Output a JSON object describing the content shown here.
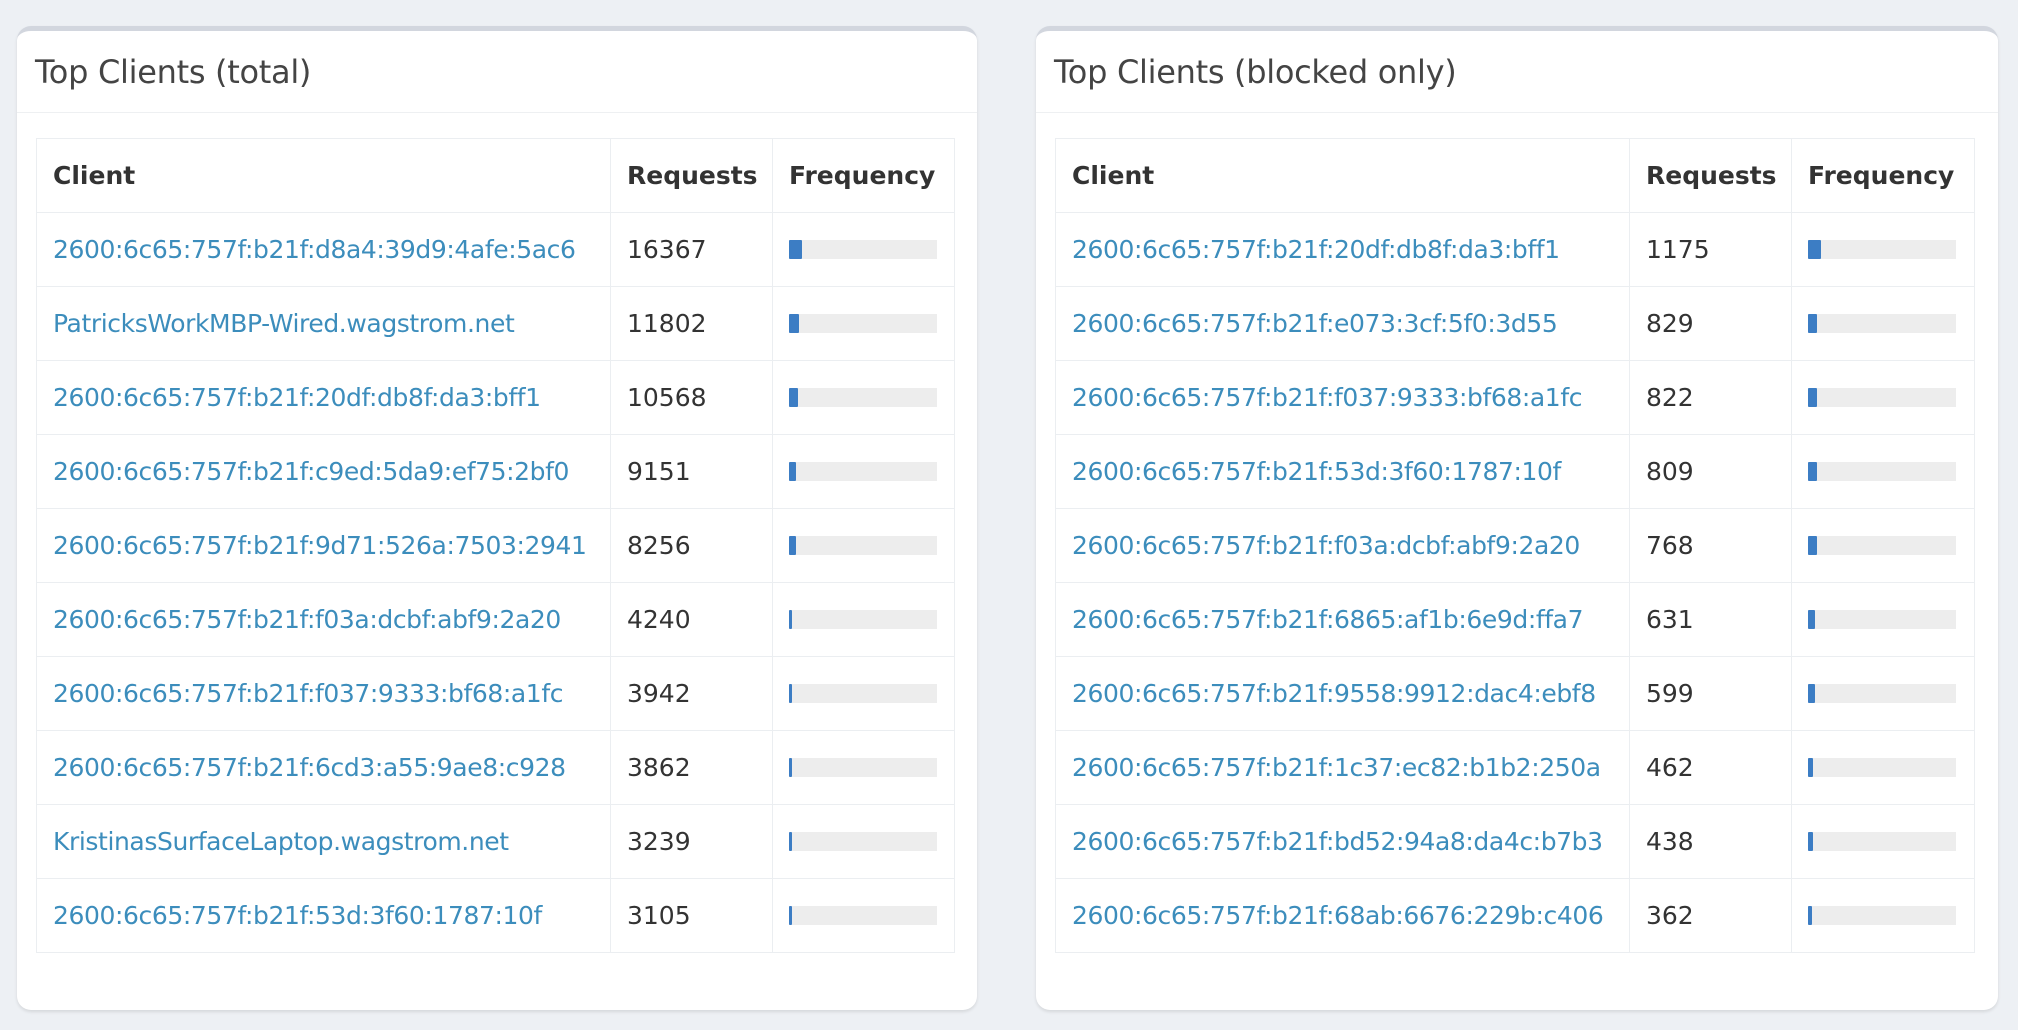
{
  "left_panel": {
    "title": "Top Clients (total)",
    "headers": {
      "client": "Client",
      "requests": "Requests",
      "frequency": "Frequency"
    },
    "rows": [
      {
        "client": "2600:6c65:757f:b21f:d8a4:39d9:4afe:5ac6",
        "requests": "16367",
        "frequency": 0.09
      },
      {
        "client": "PatricksWorkMBP-Wired.wagstrom.net",
        "requests": "11802",
        "frequency": 0.065
      },
      {
        "client": "2600:6c65:757f:b21f:20df:db8f:da3:bff1",
        "requests": "10568",
        "frequency": 0.058
      },
      {
        "client": "2600:6c65:757f:b21f:c9ed:5da9:ef75:2bf0",
        "requests": "9151",
        "frequency": 0.05
      },
      {
        "client": "2600:6c65:757f:b21f:9d71:526a:7503:2941",
        "requests": "8256",
        "frequency": 0.045
      },
      {
        "client": "2600:6c65:757f:b21f:f03a:dcbf:abf9:2a20",
        "requests": "4240",
        "frequency": 0.023
      },
      {
        "client": "2600:6c65:757f:b21f:f037:9333:bf68:a1fc",
        "requests": "3942",
        "frequency": 0.022
      },
      {
        "client": "2600:6c65:757f:b21f:6cd3:a55:9ae8:c928",
        "requests": "3862",
        "frequency": 0.021
      },
      {
        "client": "KristinasSurfaceLaptop.wagstrom.net",
        "requests": "3239",
        "frequency": 0.018
      },
      {
        "client": "2600:6c65:757f:b21f:53d:3f60:1787:10f",
        "requests": "3105",
        "frequency": 0.017
      }
    ]
  },
  "right_panel": {
    "title": "Top Clients (blocked only)",
    "headers": {
      "client": "Client",
      "requests": "Requests",
      "frequency": "Frequency"
    },
    "rows": [
      {
        "client": "2600:6c65:757f:b21f:20df:db8f:da3:bff1",
        "requests": "1175",
        "frequency": 0.09
      },
      {
        "client": "2600:6c65:757f:b21f:e073:3cf:5f0:3d55",
        "requests": "829",
        "frequency": 0.064
      },
      {
        "client": "2600:6c65:757f:b21f:f037:9333:bf68:a1fc",
        "requests": "822",
        "frequency": 0.063
      },
      {
        "client": "2600:6c65:757f:b21f:53d:3f60:1787:10f",
        "requests": "809",
        "frequency": 0.062
      },
      {
        "client": "2600:6c65:757f:b21f:f03a:dcbf:abf9:2a20",
        "requests": "768",
        "frequency": 0.059
      },
      {
        "client": "2600:6c65:757f:b21f:6865:af1b:6e9d:ffa7",
        "requests": "631",
        "frequency": 0.049
      },
      {
        "client": "2600:6c65:757f:b21f:9558:9912:dac4:ebf8",
        "requests": "599",
        "frequency": 0.046
      },
      {
        "client": "2600:6c65:757f:b21f:1c37:ec82:b1b2:250a",
        "requests": "462",
        "frequency": 0.036
      },
      {
        "client": "2600:6c65:757f:b21f:bd52:94a8:da4c:b7b3",
        "requests": "438",
        "frequency": 0.034
      },
      {
        "client": "2600:6c65:757f:b21f:68ab:6676:229b:c406",
        "requests": "362",
        "frequency": 0.028
      }
    ]
  },
  "colors": {
    "link": "#3c8dbc",
    "bar_fill": "#3c7dc4",
    "bar_track": "#ededed",
    "page_background": "#edf0f4"
  }
}
